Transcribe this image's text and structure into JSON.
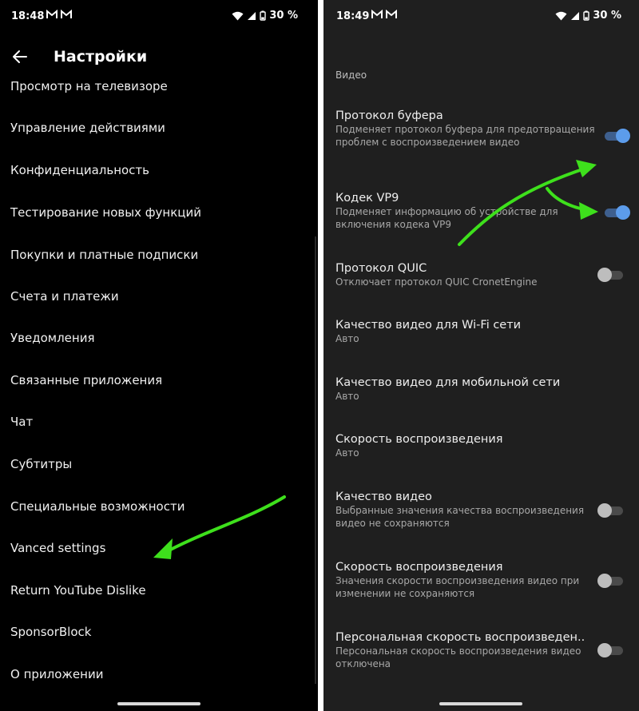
{
  "left_screen": {
    "status_bar": {
      "time": "18:48",
      "battery": "30 %"
    },
    "app_bar": {
      "title": "Настройки"
    },
    "menu_items": [
      "Просмотр на телевизоре",
      "Управление действиями",
      "Конфиденциальность",
      "Тестирование новых функций",
      "Покупки и платные подписки",
      "Счета и платежи",
      "Уведомления",
      "Связанные приложения",
      "Чат",
      "Субтитры",
      "Специальные возможности",
      "Vanced settings",
      "Return YouTube Dislike",
      "SponsorBlock",
      "О приложении"
    ]
  },
  "right_screen": {
    "status_bar": {
      "time": "18:49",
      "battery": "30 %"
    },
    "section": "Видео",
    "prefs": [
      {
        "title": "Протокол буфера",
        "summary": "Подменяет протокол буфера для предотвращения проблем с воспроизведением видео",
        "toggle": true
      },
      {
        "title": "Кодек VP9",
        "summary": "Подменяет информацию об устройстве для включения кодека VP9",
        "toggle": true
      },
      {
        "title": "Протокол QUIC",
        "summary": "Отключает протокол QUIC CronetEngine",
        "toggle": false
      },
      {
        "title": "Качество видео для Wi-Fi сети",
        "summary": "Авто"
      },
      {
        "title": "Качество видео для мобильной сети",
        "summary": "Авто"
      },
      {
        "title": "Скорость воспроизведения",
        "summary": "Авто"
      },
      {
        "title": "Качество видео",
        "summary": "Выбранные значения качества воспроизведения видео не сохраняются",
        "toggle": false
      },
      {
        "title": "Скорость воспроизведения",
        "summary": "Значения скорости воспроизведения видео при изменении не сохраняются",
        "toggle": false
      },
      {
        "title": "Персональная скорость воспроизведен..",
        "summary": "Персональная скорость воспроизведения видео отключена",
        "toggle": false
      }
    ]
  },
  "colors": {
    "toggle_on": "#5c9ceb",
    "toggle_off": "#bdbdbd",
    "annotation_arrow": "#3ee01c"
  },
  "icons": [
    "back-arrow-icon",
    "gmail-icon",
    "wifi-icon",
    "signal-icon",
    "battery-icon"
  ]
}
